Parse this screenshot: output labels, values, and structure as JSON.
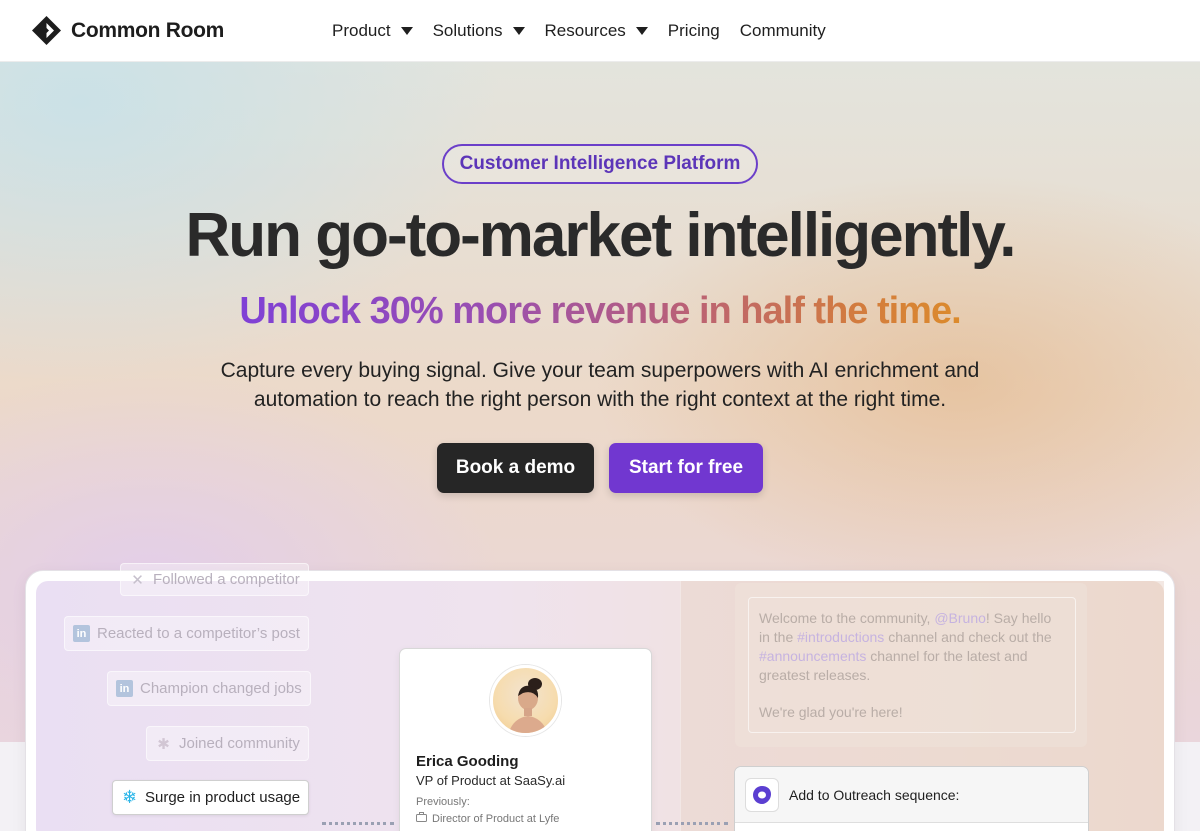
{
  "nav": {
    "brand": "Common Room",
    "items": [
      {
        "label": "Product",
        "has_caret": true
      },
      {
        "label": "Solutions",
        "has_caret": true
      },
      {
        "label": "Resources",
        "has_caret": true
      },
      {
        "label": "Pricing",
        "has_caret": false
      },
      {
        "label": "Community",
        "has_caret": false
      }
    ]
  },
  "hero": {
    "badge": "Customer Intelligence Platform",
    "headline": "Run go-to-market intelligently.",
    "subheadline": "Unlock 30% more revenue in half the time.",
    "body_line1": "Capture every buying signal. Give your team superpowers with AI enrichment and",
    "body_line2": "automation to reach the right person with the right context at the right time.",
    "cta_primary": "Book a demo",
    "cta_secondary": "Start for free"
  },
  "product_preview": {
    "signals": [
      {
        "label": "Followed a competitor",
        "icon": "x-icon"
      },
      {
        "label": "Reacted to a competitor’s post",
        "icon": "linkedin-icon"
      },
      {
        "label": "Champion changed jobs",
        "icon": "linkedin-icon"
      },
      {
        "label": "Joined community",
        "icon": "slack-icon"
      },
      {
        "label": "Surge in product usage",
        "icon": "snowflake-icon"
      }
    ],
    "profile": {
      "name": "Erica Gooding",
      "title": "VP of Product at SaaSy.ai",
      "previously_label": "Previously:",
      "previous_role": "Director of Product at Lyfe"
    },
    "chat": {
      "p1": "Welcome to the community, ",
      "mention1": "@Bruno",
      "p2": "! Say hello in the ",
      "mention2": "#introductions",
      "p3": " channel and check out the ",
      "mention3": "#announcements",
      "p4": " channel for the latest and greatest releases.",
      "closing": "We're glad you're here!"
    },
    "outreach_label": "Add to Outreach sequence:"
  },
  "colors": {
    "accent": "#7137d0",
    "dark_button": "#262626",
    "badge_border": "#6b3fc9"
  }
}
